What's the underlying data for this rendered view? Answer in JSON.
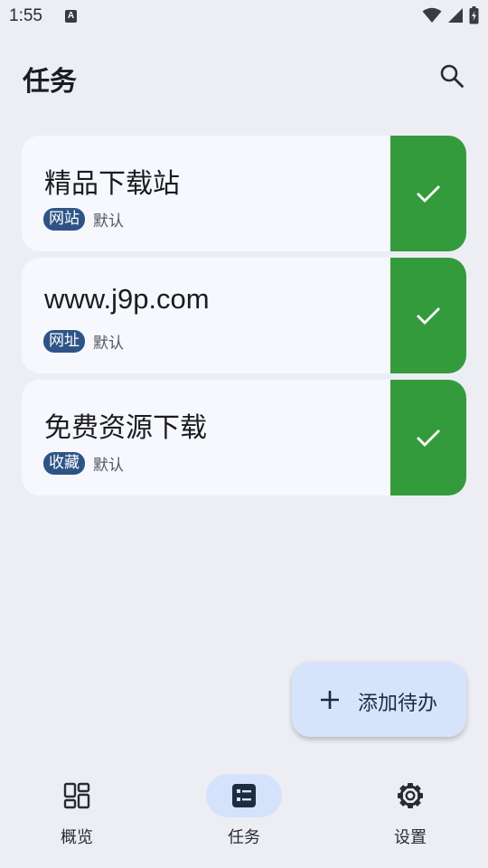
{
  "status_bar": {
    "time": "1:55",
    "notification_icon": "A",
    "icons": [
      "wifi-icon",
      "signal-icon",
      "battery-icon"
    ]
  },
  "app_bar": {
    "title": "任务",
    "search_icon": "search-icon"
  },
  "tasks": [
    {
      "title": "精品下载站",
      "tag": "网站",
      "group": "默认",
      "completed": true
    },
    {
      "title": "www.j9p.com",
      "tag": "网址",
      "group": "默认",
      "completed": true
    },
    {
      "title": "免费资源下载",
      "tag": "收藏",
      "group": "默认",
      "completed": true
    }
  ],
  "fab": {
    "icon": "plus-icon",
    "label": "添加待办"
  },
  "bottom_nav": {
    "items": [
      {
        "label": "概览",
        "icon": "dashboard-icon",
        "active": false
      },
      {
        "label": "任务",
        "icon": "task-list-icon",
        "active": true
      },
      {
        "label": "设置",
        "icon": "gear-icon",
        "active": false
      }
    ]
  },
  "colors": {
    "background": "#eceef4",
    "card": "#f7f8fd",
    "done_green": "#349b3c",
    "tag_blue": "#2e5486",
    "fab_bg": "#d7e3fb",
    "nav_active": "#d4e2fb"
  }
}
